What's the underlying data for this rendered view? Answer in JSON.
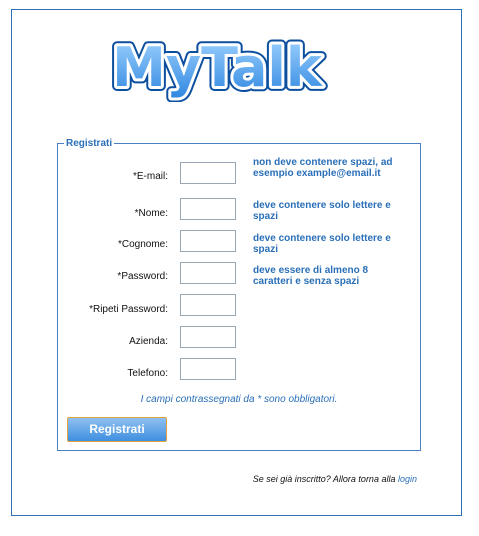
{
  "logo_text": "MyTalk",
  "form": {
    "legend": "Registrati",
    "fields": [
      {
        "label": "*E-mail:",
        "value": "",
        "hint": "non deve contenere spazi, ad esempio example@email.it"
      },
      {
        "label": "*Nome:",
        "value": "",
        "hint": "deve contenere solo lettere e spazi"
      },
      {
        "label": "*Cognome:",
        "value": "",
        "hint": "deve contenere solo lettere e spazi"
      },
      {
        "label": "*Password:",
        "value": "",
        "hint": "deve essere di almeno 8 caratteri e senza spazi"
      },
      {
        "label": "*Ripeti Password:",
        "value": ""
      },
      {
        "label": "Azienda:",
        "value": ""
      },
      {
        "label": "Telefono:",
        "value": ""
      }
    ],
    "required_note": "I campi contrassegnati da * sono obbligatori.",
    "submit_label": "Registrati"
  },
  "footer": {
    "text": "Se sei già inscritto? Allora torna alla",
    "link_label": "login"
  },
  "colors": {
    "accent": "#2a6fb7",
    "button_border": "#e0a43a"
  }
}
